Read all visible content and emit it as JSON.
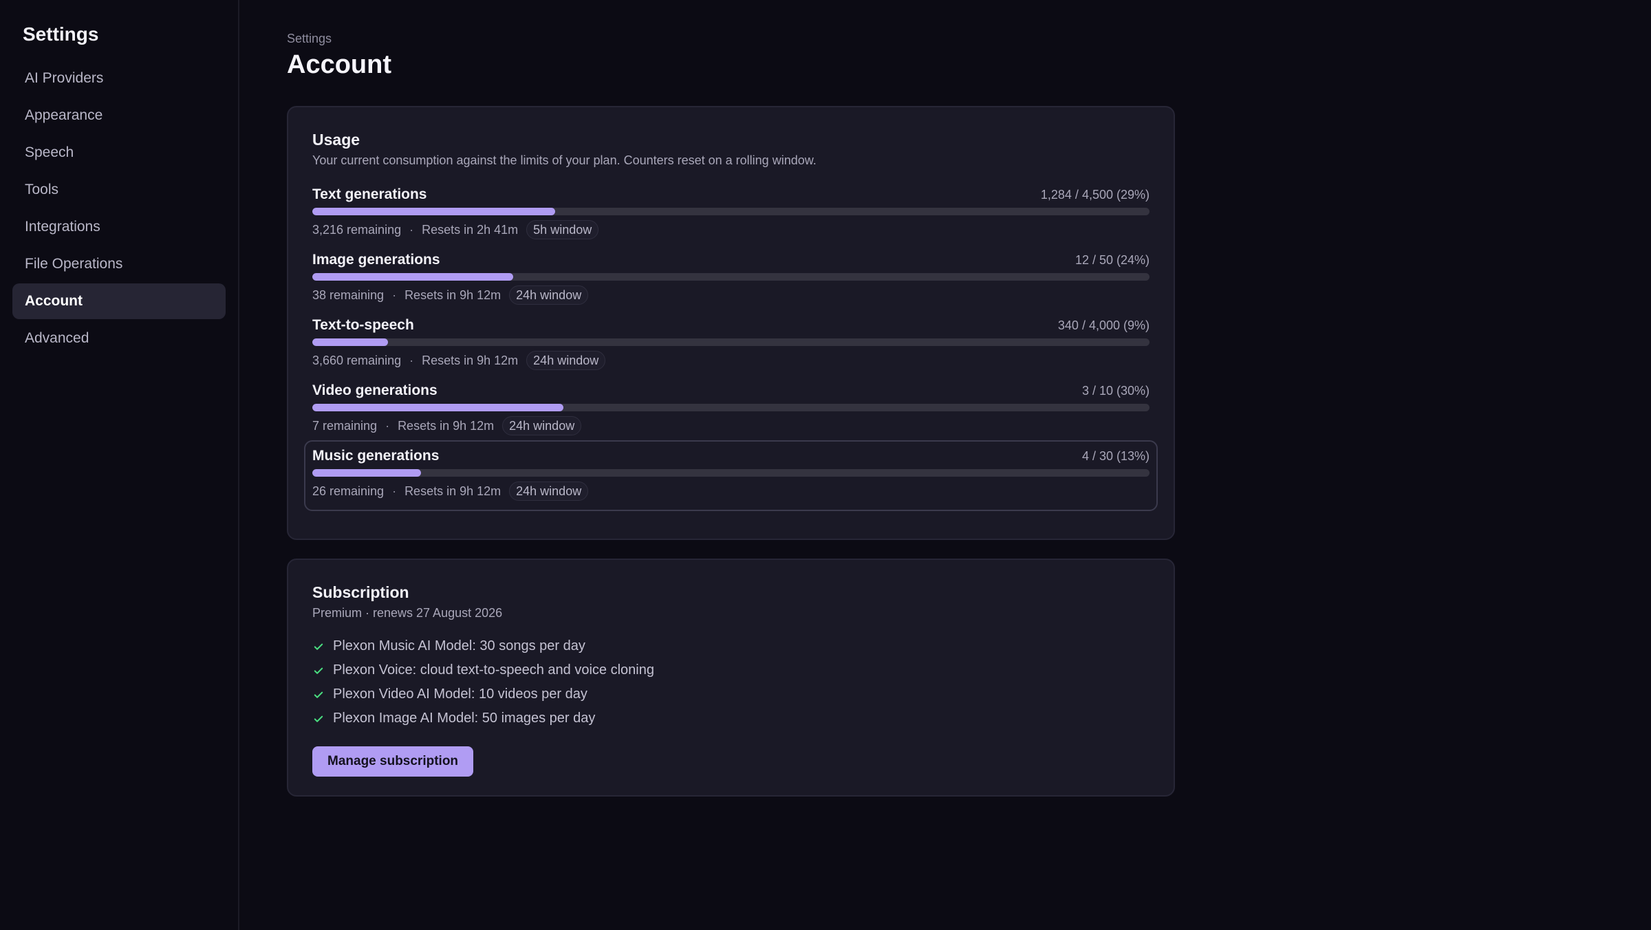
{
  "sidebar": {
    "title": "Settings",
    "items": [
      {
        "label": "AI Providers"
      },
      {
        "label": "Appearance"
      },
      {
        "label": "Speech"
      },
      {
        "label": "Tools"
      },
      {
        "label": "Integrations"
      },
      {
        "label": "File Operations"
      },
      {
        "label": "Account",
        "active": true
      },
      {
        "label": "Advanced"
      }
    ]
  },
  "header": {
    "breadcrumb": "Settings",
    "title": "Account"
  },
  "usage": {
    "title": "Usage",
    "description": "Your current consumption against the limits of your plan. Counters reset on a rolling window.",
    "items": [
      {
        "name": "Text generations",
        "count": "1,284 / 4,500 (29%)",
        "fraction": 0.29,
        "remaining": "3,216 remaining",
        "resets": "Resets in 2h 41m",
        "window": "5h window"
      },
      {
        "name": "Image generations",
        "count": "12 / 50 (24%)",
        "fraction": 0.24,
        "remaining": "38 remaining",
        "resets": "Resets in 9h 12m",
        "window": "24h window"
      },
      {
        "name": "Text-to-speech",
        "count": "340 / 4,000 (9%)",
        "fraction": 0.09,
        "remaining": "3,660 remaining",
        "resets": "Resets in 9h 12m",
        "window": "24h window"
      },
      {
        "name": "Video generations",
        "count": "3 / 10 (30%)",
        "fraction": 0.3,
        "remaining": "7 remaining",
        "resets": "Resets in 9h 12m",
        "window": "24h window"
      },
      {
        "name": "Music generations",
        "count": "4 / 30 (13%)",
        "fraction": 0.13,
        "remaining": "26 remaining",
        "resets": "Resets in 9h 12m",
        "window": "24h window"
      }
    ],
    "separator": "·"
  },
  "subscription": {
    "title": "Subscription",
    "plan_line": "Premium · renews 27 August 2026",
    "features": [
      "Plexon Music AI Model: 30 songs per day",
      "Plexon Voice: cloud text-to-speech and voice cloning",
      "Plexon Video AI Model: 10 videos per day",
      "Plexon Image AI Model: 50 images per day"
    ],
    "manage_label": "Manage subscription"
  },
  "icons": {
    "feature": "check-icon"
  },
  "colors": {
    "accent": "#b09cf3",
    "check": "#4ade80",
    "background": "#0c0b14",
    "card": "#1a1926"
  }
}
